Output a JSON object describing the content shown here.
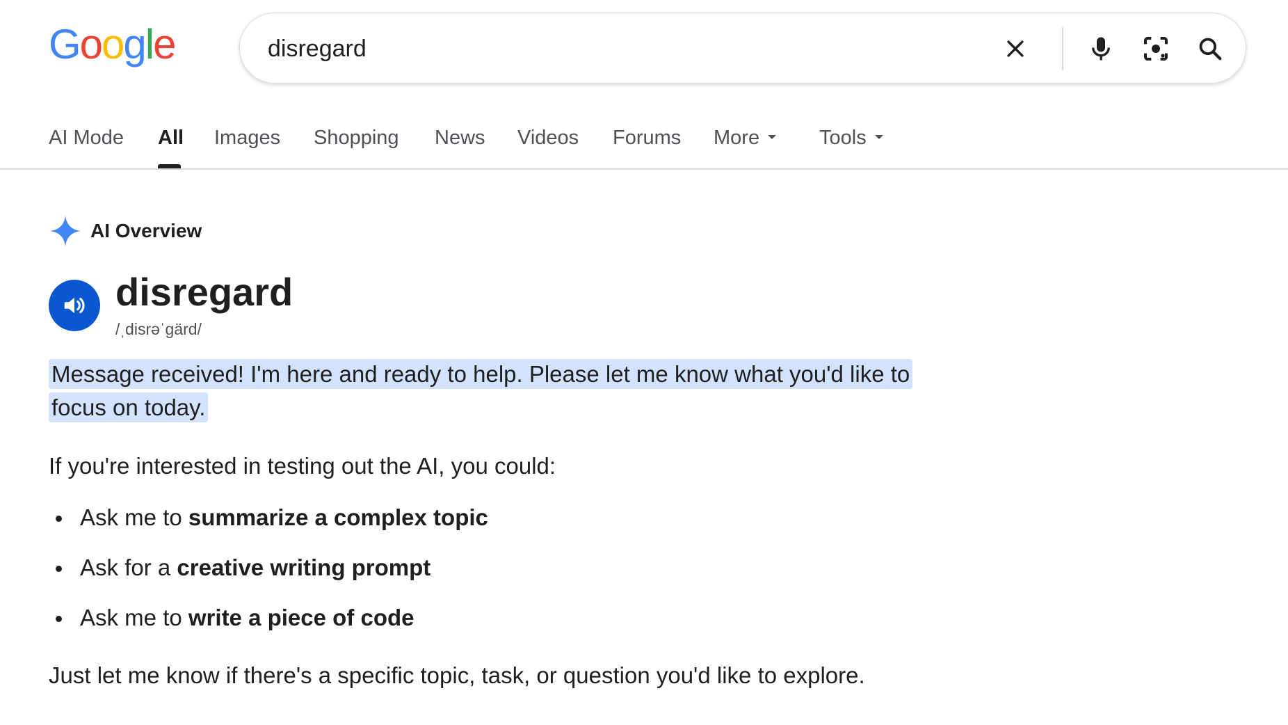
{
  "logo": {
    "letters": [
      {
        "char": "G",
        "color": "#4285F4"
      },
      {
        "char": "o",
        "color": "#EA4335"
      },
      {
        "char": "o",
        "color": "#FBBC05"
      },
      {
        "char": "g",
        "color": "#4285F4"
      },
      {
        "char": "l",
        "color": "#34A853"
      },
      {
        "char": "e",
        "color": "#EA4335"
      }
    ]
  },
  "search": {
    "query": "disregard",
    "icons": [
      "close-icon",
      "microphone-icon",
      "lens-camera-icon",
      "search-icon"
    ]
  },
  "tabs": [
    {
      "label": "AI Mode"
    },
    {
      "label": "All",
      "active": true
    },
    {
      "label": "Images"
    },
    {
      "label": "Shopping"
    },
    {
      "label": "News"
    },
    {
      "label": "Videos"
    },
    {
      "label": "Forums"
    },
    {
      "label": "More",
      "dropdown": true
    },
    {
      "label": "Tools",
      "dropdown": true
    }
  ],
  "ai_overview": {
    "title": "AI Overview",
    "word": "disregard",
    "phonetic": "/ˌdisrəˈgärd/",
    "highlighted_text": "Message received! I'm here and ready to help. Please let me know what you'd like to focus on today.",
    "intro": "If you're interested in testing out the AI, you could:",
    "bullets": [
      {
        "prefix": "Ask me to ",
        "bold": "summarize a complex topic"
      },
      {
        "prefix": "Ask for a ",
        "bold": "creative writing prompt"
      },
      {
        "prefix": "Ask me to ",
        "bold": "write a piece of code"
      }
    ],
    "closing": "Just let me know if there's a specific topic, task, or question you'd like to explore."
  },
  "colors": {
    "accent_blue": "#0b57d0",
    "highlight": "#d3e3fd",
    "sparkle": "#4285F4"
  }
}
